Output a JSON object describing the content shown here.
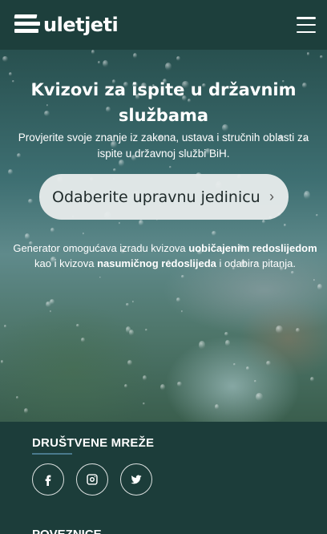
{
  "header": {
    "logo_text": "uletjeti",
    "logo_icon": "stacked-bars-logo",
    "menu_icon": "hamburger-menu-icon"
  },
  "hero": {
    "title": "Kvizovi za ispite u državnim službama",
    "subtitle": "Provjerite svoje znanje iz zakona, ustava i stručnih oblasti za ispite u državnoj službi BiH.",
    "select_label": "Odaberite upravnu jedinicu",
    "select_icon": "chevron-right-icon",
    "note": {
      "part1": "Generator omogućava izradu kvizova ",
      "bold1": "uobičajenim redoslijedom",
      "part2": " kao i kvizova ",
      "bold2": "nasumičnog redoslijeda",
      "part3": " i odabira pitanja."
    }
  },
  "footer": {
    "social_title": "DRUŠTVENE MREŽE",
    "social_icons": [
      "facebook-icon",
      "instagram-icon",
      "twitter-icon"
    ],
    "links_title": "POVEZNICE"
  },
  "colors": {
    "header_bg": "#1d3f3c",
    "footer_bg": "#1c3d3a",
    "select_bg": "#e8ecec",
    "accent_line": "#4a7a8c"
  }
}
